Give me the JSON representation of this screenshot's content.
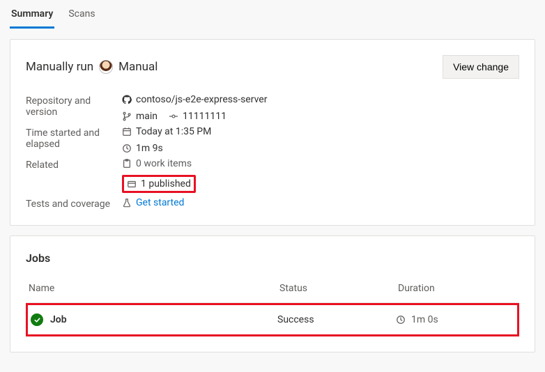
{
  "tabs": {
    "summary": "Summary",
    "scans": "Scans"
  },
  "header": {
    "run_label": "Manually run",
    "trigger": "Manual",
    "view_change": "View change"
  },
  "details": {
    "labels": {
      "repo": "Repository and version",
      "time": "Time started and elapsed",
      "related": "Related",
      "tests": "Tests and coverage"
    },
    "repo_name": "contoso/js-e2e-express-server",
    "branch": "main",
    "commit": "11111111",
    "started": "Today at 1:35 PM",
    "elapsed": "1m 9s",
    "work_items": "0 work items",
    "published": "1 published",
    "tests_link": "Get started"
  },
  "jobs": {
    "title": "Jobs",
    "headers": {
      "name": "Name",
      "status": "Status",
      "duration": "Duration"
    },
    "rows": [
      {
        "name": "Job",
        "status": "Success",
        "duration": "1m 0s"
      }
    ]
  }
}
